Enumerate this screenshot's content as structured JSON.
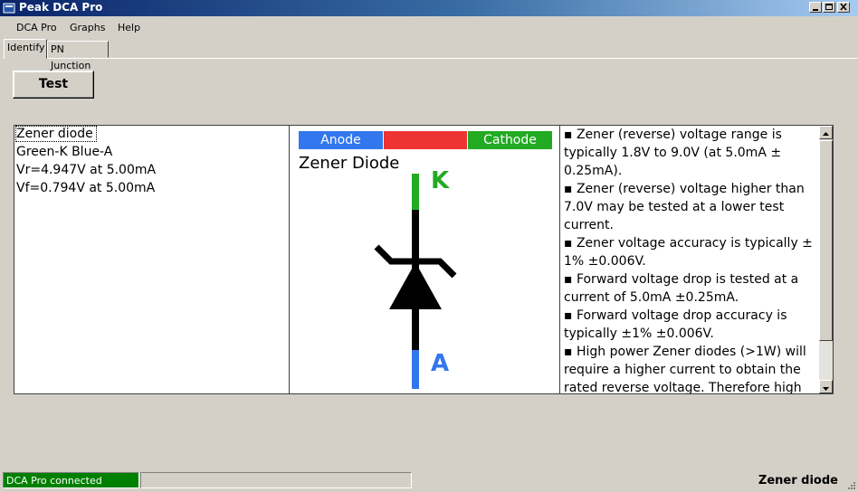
{
  "window": {
    "title": "Peak DCA Pro"
  },
  "menu": [
    "DCA Pro",
    "Graphs",
    "Help"
  ],
  "tabs": [
    "Identify",
    "PN Junction"
  ],
  "test_button": "Test",
  "results": [
    "Zener diode",
    "Green-K Blue-A",
    "Vr=4.947V at 5.00mA",
    "Vf=0.794V at 5.00mA"
  ],
  "diagram": {
    "anode_label": "Anode",
    "cathode_label": "Cathode",
    "title": "Zener Diode",
    "k_label": "K",
    "a_label": "A",
    "colors": {
      "anode": "#3377ee",
      "middle": "#ee3333",
      "cathode": "#22aa22"
    }
  },
  "notes": [
    "▪ Zener (reverse) voltage range is typically 1.8V to 9.0V (at 5.0mA ± 0.25mA).",
    "▪ Zener (reverse) voltage higher than 7.0V may be tested at a lower test current.",
    "▪ Zener voltage accuracy is typically ± 1% ±0.006V.",
    "▪ Forward voltage drop is tested at a current of 5.0mA ±0.25mA.",
    "▪ Forward voltage drop accuracy is typically ±1% ±0.006V.",
    "▪ High power Zener diodes (>1W) will require a higher current to obtain the rated reverse voltage. Therefore high"
  ],
  "status": {
    "connection": "DCA Pro connected",
    "component": "Zener diode"
  }
}
